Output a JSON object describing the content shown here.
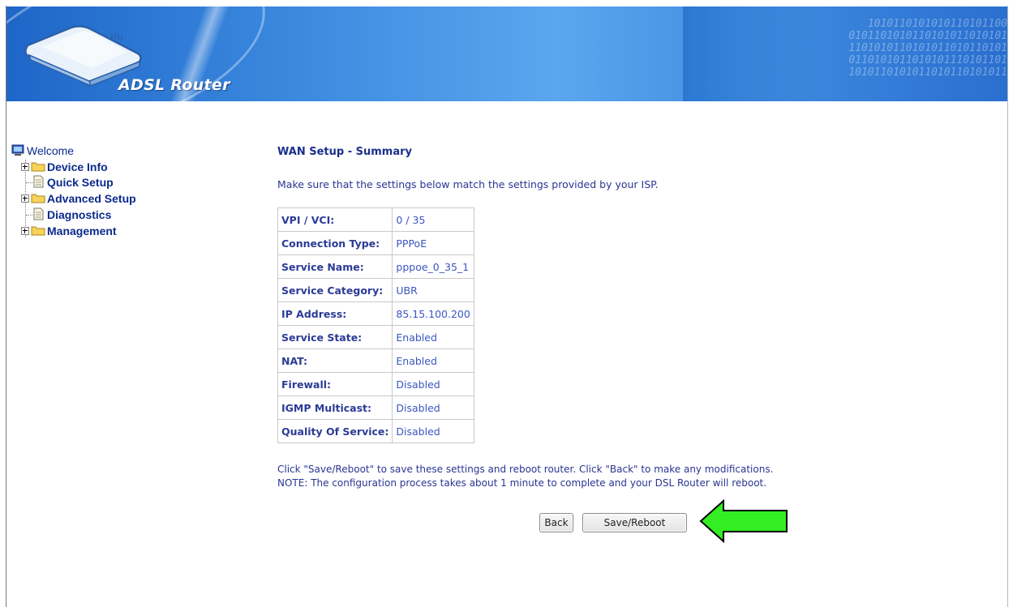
{
  "header": {
    "brand": "ADSL Router"
  },
  "sidebar": {
    "items": [
      {
        "label": "Welcome",
        "icon": "computer-icon"
      },
      {
        "label": "Device Info",
        "icon": "folder-icon"
      },
      {
        "label": "Quick Setup",
        "icon": "document-icon"
      },
      {
        "label": "Advanced Setup",
        "icon": "folder-icon"
      },
      {
        "label": "Diagnostics",
        "icon": "document-icon"
      },
      {
        "label": "Management",
        "icon": "folder-icon"
      }
    ]
  },
  "main": {
    "title": "WAN Setup - Summary",
    "intro": "Make sure that the settings below match the settings provided by your ISP.",
    "rows": [
      {
        "key": "VPI / VCI:",
        "value": "0 / 35"
      },
      {
        "key": "Connection Type:",
        "value": "PPPoE"
      },
      {
        "key": "Service Name:",
        "value": "pppoe_0_35_1"
      },
      {
        "key": "Service Category:",
        "value": "UBR"
      },
      {
        "key": "IP Address:",
        "value": "85.15.100.200"
      },
      {
        "key": "Service State:",
        "value": "Enabled"
      },
      {
        "key": "NAT:",
        "value": "Enabled"
      },
      {
        "key": "Firewall:",
        "value": "Disabled"
      },
      {
        "key": "IGMP Multicast:",
        "value": "Disabled"
      },
      {
        "key": "Quality Of Service:",
        "value": "Disabled"
      }
    ],
    "note_line1": "Click \"Save/Reboot\" to save these settings and reboot router. Click \"Back\" to make any modifications.",
    "note_line2": "NOTE: The configuration process takes about 1 minute to complete and your DSL Router will reboot.",
    "back_label": "Back",
    "save_label": "Save/Reboot"
  },
  "colors": {
    "header": "#3d8be0",
    "arrow": "#33ee22",
    "link": "#0b2a8c"
  }
}
